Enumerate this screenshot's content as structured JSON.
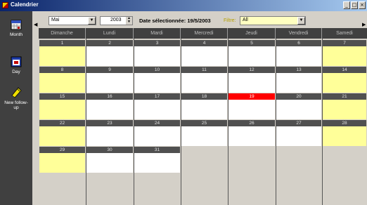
{
  "window": {
    "title": "Calendrier",
    "min_glyph": "_",
    "max_glyph": "□",
    "close_glyph": "×"
  },
  "sidebar": {
    "items": [
      {
        "label": "Month",
        "icon": "month-calendar-icon"
      },
      {
        "label": "Day",
        "icon": "day-calendar-icon"
      },
      {
        "label": "New follow-up",
        "icon": "new-followup-icon"
      }
    ]
  },
  "toolbar": {
    "prev_arrow": "◀",
    "next_arrow": "▶",
    "month_value": "Mai",
    "year_value": "2003",
    "selected_date_label": "Date sélectionnée: 19/5/2003",
    "filter_label": "Filtre:",
    "filter_value": "All"
  },
  "calendar": {
    "day_names": [
      "Dimanche",
      "Lundi",
      "Mardi",
      "Mercredi",
      "Jeudi",
      "Vendredi",
      "Samedi"
    ],
    "weeks": [
      [
        "1",
        "2",
        "3",
        "4",
        "5",
        "6",
        "7"
      ],
      [
        "8",
        "9",
        "10",
        "11",
        "12",
        "13",
        "14"
      ],
      [
        "15",
        "16",
        "17",
        "18",
        "19",
        "20",
        "21"
      ],
      [
        "22",
        "23",
        "24",
        "25",
        "26",
        "27",
        "28"
      ],
      [
        "29",
        "30",
        "31"
      ]
    ],
    "today": "19",
    "colors": {
      "weekend": "#ffff99",
      "today": "#ff0000",
      "header": "#404040"
    }
  }
}
